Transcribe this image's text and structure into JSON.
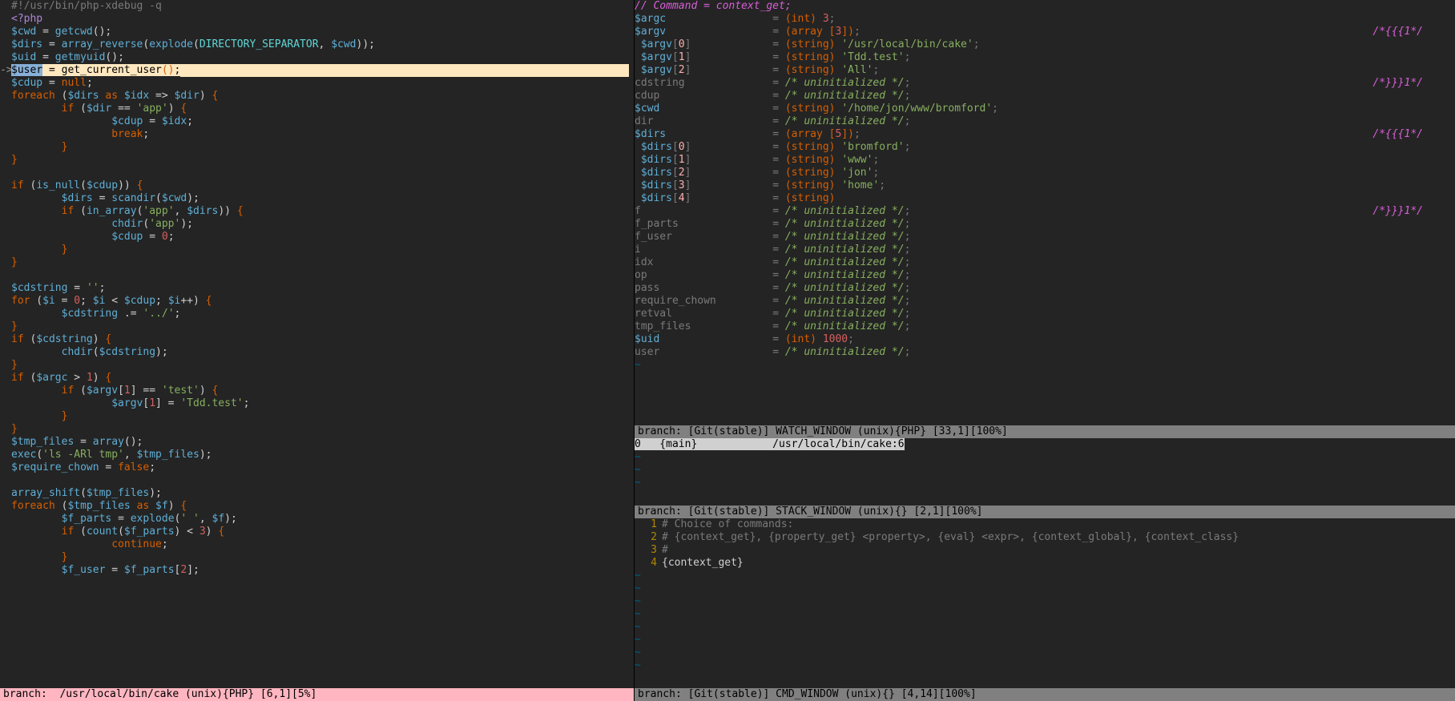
{
  "statusbars": {
    "left": "branch:  /usr/local/bin/cake (unix){PHP} [6,1][5%]",
    "watch": "branch: [Git(stable)] WATCH_WINDOW (unix){PHP} [33,1][100%]",
    "stack": "branch: [Git(stable)] STACK_WINDOW (unix){} [2,1][100%]",
    "cmd": "branch: [Git(stable)] CMD_WINDOW (unix){} [4,14][100%]"
  },
  "left_code": [
    "#!/usr/bin/php-xdebug -q",
    "<?php",
    "$cwd = getcwd();",
    "$dirs = array_reverse(explode(DIRECTORY_SEPARATOR, $cwd));",
    "$uid = getmyuid();",
    "$user = get_current_user();",
    "$cdup = null;",
    "foreach ($dirs as $idx => $dir) {",
    "        if ($dir == 'app') {",
    "                $cdup = $idx;",
    "                break;",
    "        }",
    "}",
    "",
    "if (is_null($cdup)) {",
    "        $dirs = scandir($cwd);",
    "        if (in_array('app', $dirs)) {",
    "                chdir('app');",
    "                $cdup = 0;",
    "        }",
    "}",
    "",
    "$cdstring = '';",
    "for ($i = 0; $i < $cdup; $i++) {",
    "        $cdstring .= '../';",
    "}",
    "if ($cdstring) {",
    "        chdir($cdstring);",
    "}",
    "if ($argc > 1) {",
    "        if ($argv[1] == 'test') {",
    "                $argv[1] = 'Tdd.test';",
    "        }",
    "}",
    "$tmp_files = array();",
    "exec('ls -ARl tmp', $tmp_files);",
    "$require_chown = false;",
    "",
    "array_shift($tmp_files);",
    "foreach ($tmp_files as $f) {",
    "        $f_parts = explode(' ', $f);",
    "        if (count($f_parts) < 3) {",
    "                continue;",
    "        }",
    "        $f_user = $f_parts[2];"
  ],
  "current_line_index": 5,
  "watch": {
    "header": "// Command = context_get;",
    "rows": [
      {
        "name": "$argc",
        "eq": "= (int) 3;",
        "marker": ""
      },
      {
        "name": "$argv",
        "eq": "= (array [3]);",
        "marker": "/*{{{1*/"
      },
      {
        "name": " $argv[0]",
        "eq": "= (string) '/usr/local/bin/cake';",
        "marker": ""
      },
      {
        "name": " $argv[1]",
        "eq": "= (string) 'Tdd.test';",
        "marker": ""
      },
      {
        "name": " $argv[2]",
        "eq": "= (string) 'All';",
        "marker": ""
      },
      {
        "name": "",
        "eq": "",
        "marker": "/*}}}1*/"
      },
      {
        "name": "cdstring",
        "eq": "= /* uninitialized */;",
        "marker": ""
      },
      {
        "name": "cdup",
        "eq": "= /* uninitialized */;",
        "marker": ""
      },
      {
        "name": "$cwd",
        "eq": "= (string) '/home/jon/www/bromford';",
        "marker": ""
      },
      {
        "name": "dir",
        "eq": "= /* uninitialized */;",
        "marker": ""
      },
      {
        "name": "$dirs",
        "eq": "= (array [5]);",
        "marker": "/*{{{1*/"
      },
      {
        "name": " $dirs[0]",
        "eq": "= (string) 'bromford';",
        "marker": ""
      },
      {
        "name": " $dirs[1]",
        "eq": "= (string) 'www';",
        "marker": ""
      },
      {
        "name": " $dirs[2]",
        "eq": "= (string) 'jon';",
        "marker": ""
      },
      {
        "name": " $dirs[3]",
        "eq": "= (string) 'home';",
        "marker": ""
      },
      {
        "name": " $dirs[4]",
        "eq": "= (string)",
        "marker": ""
      },
      {
        "name": "",
        "eq": "",
        "marker": "/*}}}1*/"
      },
      {
        "name": "f",
        "eq": "= /* uninitialized */;",
        "marker": ""
      },
      {
        "name": "f_parts",
        "eq": "= /* uninitialized */;",
        "marker": ""
      },
      {
        "name": "f_user",
        "eq": "= /* uninitialized */;",
        "marker": ""
      },
      {
        "name": "i",
        "eq": "= /* uninitialized */;",
        "marker": ""
      },
      {
        "name": "idx",
        "eq": "= /* uninitialized */;",
        "marker": ""
      },
      {
        "name": "op",
        "eq": "= /* uninitialized */;",
        "marker": ""
      },
      {
        "name": "pass",
        "eq": "= /* uninitialized */;",
        "marker": ""
      },
      {
        "name": "require_chown",
        "eq": "= /* uninitialized */;",
        "marker": ""
      },
      {
        "name": "retval",
        "eq": "= /* uninitialized */;",
        "marker": ""
      },
      {
        "name": "tmp_files",
        "eq": "= /* uninitialized */;",
        "marker": ""
      },
      {
        "name": "$uid",
        "eq": "= (int) 1000;",
        "marker": ""
      },
      {
        "name": "user",
        "eq": "= /* uninitialized */;",
        "marker": ""
      }
    ]
  },
  "stack": "0   {main}            /usr/local/bin/cake:6",
  "cmd": [
    "# Choice of commands:",
    "# {context_get}, {property_get} <property>, {eval} <expr>, {context_global}, {context_class}",
    "#",
    "{context_get}"
  ]
}
